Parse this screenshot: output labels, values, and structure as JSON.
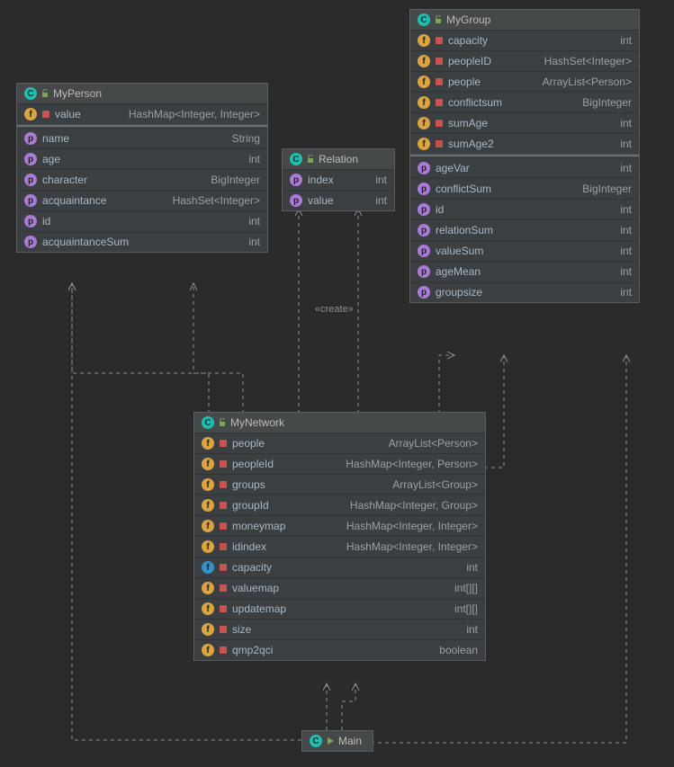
{
  "classes": {
    "myPerson": {
      "title": "MyPerson",
      "fields": [
        {
          "icon": "f",
          "lock": "red",
          "name": "value",
          "type": "HashMap<Integer, Integer>"
        }
      ],
      "props": [
        {
          "icon": "p",
          "name": "name",
          "type": "String"
        },
        {
          "icon": "p",
          "name": "age",
          "type": "int"
        },
        {
          "icon": "p",
          "name": "character",
          "type": "BigInteger"
        },
        {
          "icon": "p",
          "name": "acquaintance",
          "type": "HashSet<Integer>"
        },
        {
          "icon": "p",
          "name": "id",
          "type": "int"
        },
        {
          "icon": "p",
          "name": "acquaintanceSum",
          "type": "int"
        }
      ]
    },
    "relation": {
      "title": "Relation",
      "props": [
        {
          "icon": "p",
          "name": "index",
          "type": "int"
        },
        {
          "icon": "p",
          "name": "value",
          "type": "int"
        }
      ]
    },
    "myGroup": {
      "title": "MyGroup",
      "fields": [
        {
          "icon": "f",
          "lock": "red",
          "name": "capacity",
          "type": "int"
        },
        {
          "icon": "f",
          "lock": "red",
          "name": "peopleID",
          "type": "HashSet<Integer>"
        },
        {
          "icon": "f",
          "lock": "red",
          "name": "people",
          "type": "ArrayList<Person>"
        },
        {
          "icon": "f",
          "lock": "red",
          "name": "conflictsum",
          "type": "BigInteger"
        },
        {
          "icon": "f",
          "lock": "red",
          "name": "sumAge",
          "type": "int"
        },
        {
          "icon": "f",
          "lock": "red",
          "name": "sumAge2",
          "type": "int"
        }
      ],
      "props": [
        {
          "icon": "p",
          "name": "ageVar",
          "type": "int"
        },
        {
          "icon": "p",
          "name": "conflictSum",
          "type": "BigInteger"
        },
        {
          "icon": "p",
          "name": "id",
          "type": "int"
        },
        {
          "icon": "p",
          "name": "relationSum",
          "type": "int"
        },
        {
          "icon": "p",
          "name": "valueSum",
          "type": "int"
        },
        {
          "icon": "p",
          "name": "ageMean",
          "type": "int"
        },
        {
          "icon": "p",
          "name": "groupsize",
          "type": "int"
        }
      ]
    },
    "myNetwork": {
      "title": "MyNetwork",
      "fields": [
        {
          "icon": "f",
          "lock": "red",
          "name": "people",
          "type": "ArrayList<Person>"
        },
        {
          "icon": "f",
          "lock": "red",
          "name": "peopleId",
          "type": "HashMap<Integer, Person>"
        },
        {
          "icon": "f",
          "lock": "red",
          "name": "groups",
          "type": "ArrayList<Group>"
        },
        {
          "icon": "f",
          "lock": "red",
          "name": "groupId",
          "type": "HashMap<Integer, Group>"
        },
        {
          "icon": "f",
          "lock": "red",
          "name": "moneymap",
          "type": "HashMap<Integer, Integer>"
        },
        {
          "icon": "f",
          "lock": "red",
          "name": "idindex",
          "type": "HashMap<Integer, Integer>"
        },
        {
          "icon": "png",
          "lock": "red",
          "name": "capacity",
          "type": "int"
        },
        {
          "icon": "f",
          "lock": "red",
          "name": "valuemap",
          "type": "int[][]"
        },
        {
          "icon": "f",
          "lock": "red",
          "name": "updatemap",
          "type": "int[][]"
        },
        {
          "icon": "f",
          "lock": "red",
          "name": "size",
          "type": "int"
        },
        {
          "icon": "f",
          "lock": "red",
          "name": "qmp2qci",
          "type": "boolean"
        }
      ]
    },
    "main": {
      "title": "Main"
    }
  },
  "stereotype": "«create»",
  "colors": {
    "bg": "#2b2b2b",
    "box": "#3c3f41",
    "border": "#5a5d5f",
    "dash": "#8a8f94"
  }
}
